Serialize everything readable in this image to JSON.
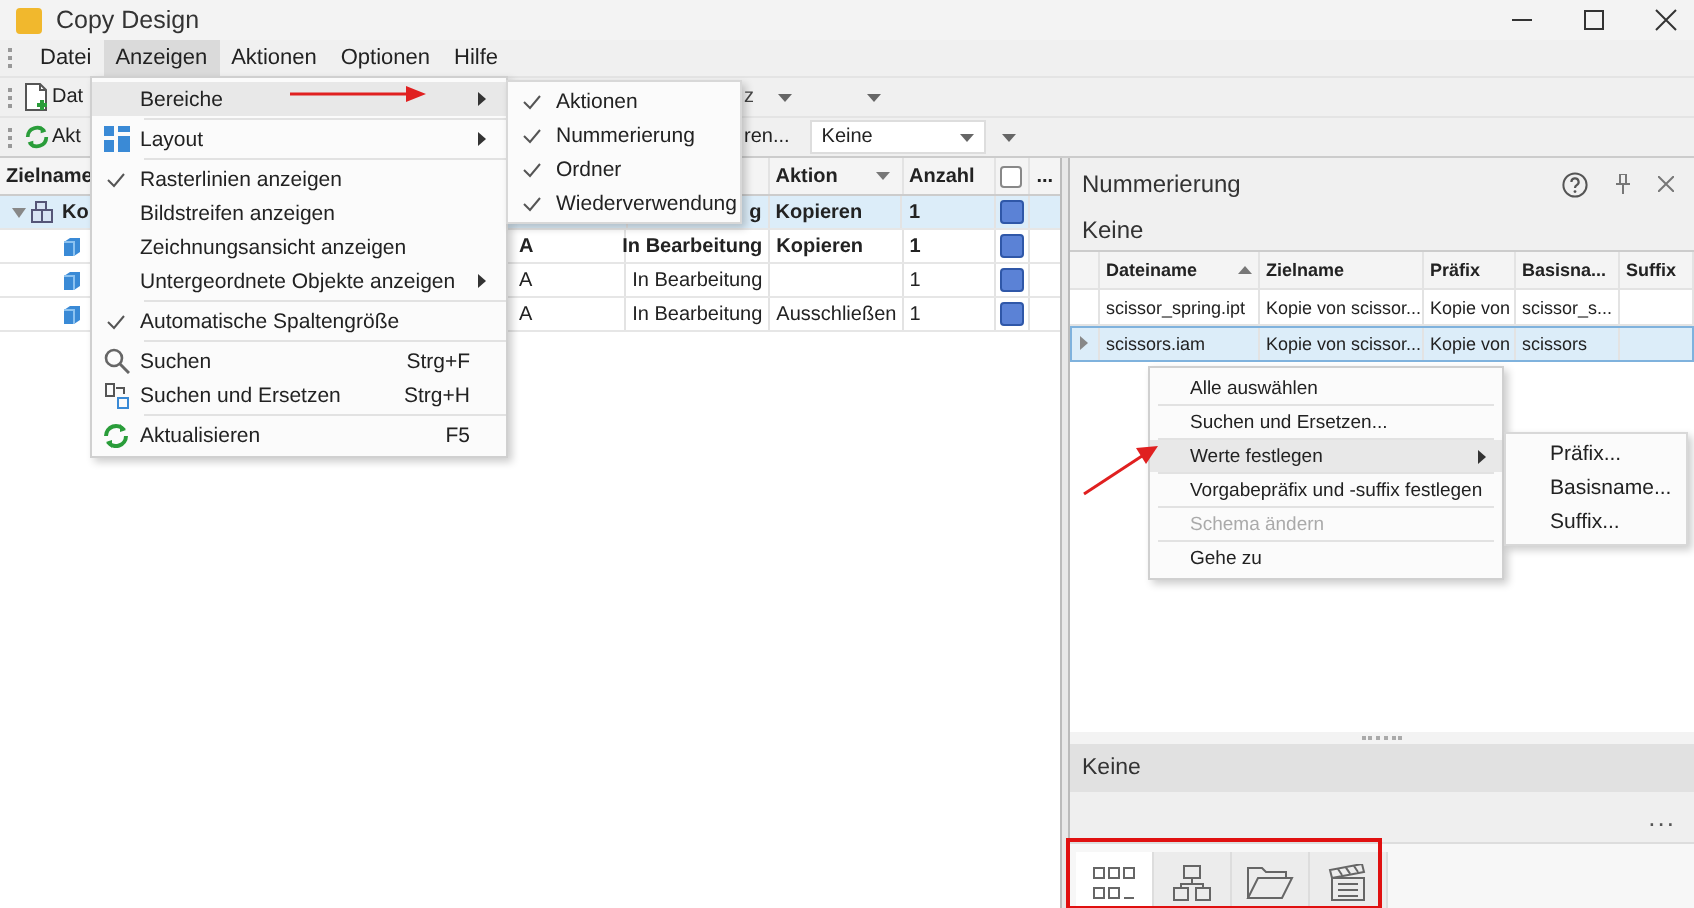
{
  "window": {
    "title": "Copy Design"
  },
  "menu_bar": [
    {
      "label": "Datei",
      "selected": false
    },
    {
      "label": "Anzeigen",
      "selected": true
    },
    {
      "label": "Aktionen",
      "selected": false
    },
    {
      "label": "Optionen",
      "selected": false
    },
    {
      "label": "Hilfe",
      "selected": false
    }
  ],
  "toolbar_1": {
    "button_label": "Dat",
    "dropdown_value": "z"
  },
  "toolbar_2": {
    "button_label": "Akt",
    "button_2_label": "ren...",
    "dropdown_value": "Keine"
  },
  "grid": {
    "header": {
      "zielname": "Zielname",
      "aktion": "Aktion",
      "anzahl": "Anzahl",
      "more": "...",
      "select_all_checked": false
    },
    "rows": [
      {
        "kind": "assembly",
        "expanded": true,
        "zielname": "Ko",
        "status": "g",
        "action": "Kopieren",
        "count": "1",
        "bold": true,
        "selected": true
      },
      {
        "kind": "part",
        "column_3": "A",
        "status": "In Bearbeitung",
        "action": "Kopieren",
        "count": "1",
        "bold": true,
        "selected": false
      },
      {
        "kind": "part",
        "column_3": "A",
        "status": "In Bearbeitung",
        "count": "1",
        "bold": false,
        "selected": false
      },
      {
        "kind": "part",
        "column_3": "A",
        "status": "In Bearbeitung",
        "action": "Ausschließen",
        "count": "1",
        "bold": false,
        "selected": false
      }
    ]
  },
  "view_menu": [
    {
      "kind": "submenu",
      "label": "Bereiche",
      "selected": true
    },
    {
      "kind": "submenu",
      "label": "Layout",
      "selected": false
    },
    {
      "kind": "toggle",
      "label": "Rasterlinien anzeigen",
      "checked": true,
      "selected": false
    },
    {
      "kind": "toggle",
      "label": "Bildstreifen anzeigen",
      "checked": false,
      "selected": false
    },
    {
      "kind": "toggle",
      "label": "Zeichnungsansicht anzeigen",
      "checked": false,
      "selected": false
    },
    {
      "kind": "submenu",
      "label": "Untergeordnete Objekte anzeigen",
      "selected": false
    },
    {
      "kind": "toggle",
      "label": "Automatische Spaltengröße",
      "checked": true,
      "selected": false
    },
    {
      "kind": "command",
      "label": "Suchen",
      "shortcut": "Strg+F",
      "selected": false
    },
    {
      "kind": "command",
      "label": "Suchen und Ersetzen",
      "shortcut": "Strg+H",
      "selected": false
    },
    {
      "kind": "command",
      "label": "Aktualisieren",
      "shortcut": "F5",
      "selected": false
    }
  ],
  "areas_submenu": [
    {
      "label": "Aktionen",
      "checked": true
    },
    {
      "label": "Nummerierung",
      "checked": true
    },
    {
      "label": "Ordner",
      "checked": true
    },
    {
      "label": "Wiederverwendung",
      "checked": true
    }
  ],
  "numbering_panel": {
    "title": "Nummerierung",
    "scheme": "Keine",
    "columns": [
      {
        "label": "Dateiname",
        "sorted": true
      },
      {
        "label": "Zielname"
      },
      {
        "label": "Präfix"
      },
      {
        "label": "Basisna..."
      },
      {
        "label": "Suffix"
      }
    ],
    "rows": [
      {
        "cells": [
          "scissor_spring.ipt",
          "Kopie von scissor...",
          "Kopie von",
          "scissor_s..."
        ],
        "selected": false
      },
      {
        "cells": [
          "scissors.iam",
          "Kopie von scissor...",
          "Kopie von",
          "scissors"
        ],
        "selected": true
      }
    ],
    "context_menu": [
      {
        "kind": "action",
        "label": "Alle auswählen",
        "disabled": false,
        "selected": false
      },
      {
        "kind": "action",
        "label": "Suchen und Ersetzen...",
        "disabled": false,
        "selected": false
      },
      {
        "kind": "submenu",
        "label": "Werte festlegen",
        "disabled": false,
        "selected": true
      },
      {
        "kind": "action",
        "label": "Vorgabepräfix und -suffix festlegen",
        "disabled": false,
        "selected": false
      },
      {
        "kind": "action",
        "label": "Schema ändern",
        "disabled": true,
        "selected": false
      },
      {
        "kind": "action",
        "label": "Gehe zu",
        "disabled": false,
        "selected": false
      }
    ],
    "values_submenu": [
      "Präfix...",
      "Basisname...",
      "Suffix..."
    ],
    "lower_section": {
      "title": "Keine",
      "more": "..."
    },
    "bottom_tabs": [
      {
        "selected": true
      },
      {
        "selected": false
      },
      {
        "selected": false
      },
      {
        "selected": false
      }
    ]
  }
}
